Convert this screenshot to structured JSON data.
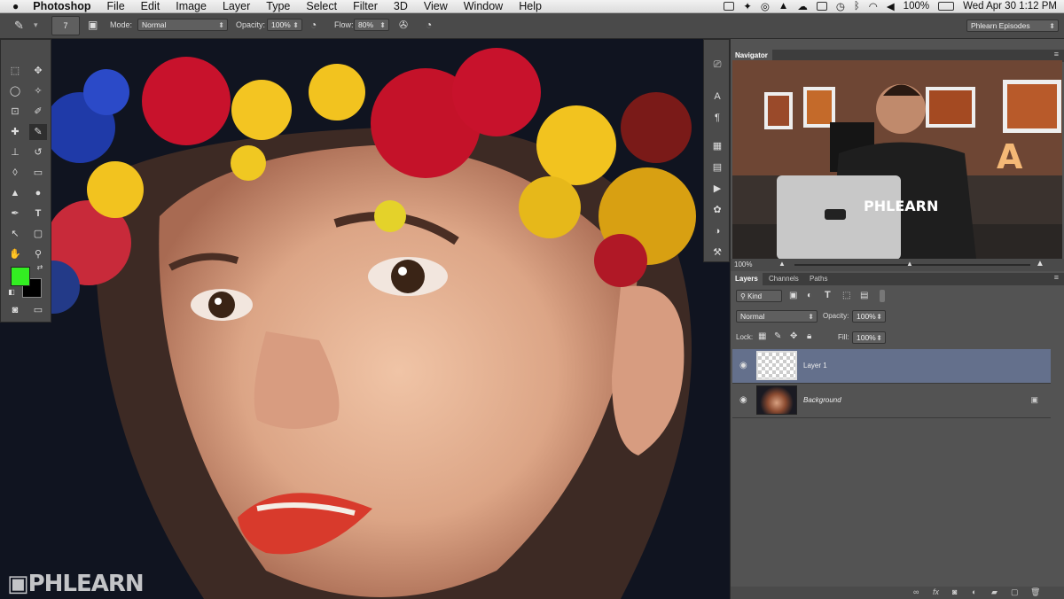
{
  "menubar": {
    "app_name": "Photoshop",
    "items": [
      "File",
      "Edit",
      "Image",
      "Layer",
      "Type",
      "Select",
      "Filter",
      "3D",
      "View",
      "Window",
      "Help"
    ],
    "battery": "100%",
    "datetime": "Wed Apr 30  1:12 PM"
  },
  "options": {
    "brush_size": "7",
    "mode_label": "Mode:",
    "mode_value": "Normal",
    "opacity_label": "Opacity:",
    "opacity_value": "100%",
    "flow_label": "Flow:",
    "flow_value": "80%",
    "workspace": "Phlearn Episodes"
  },
  "watermark": "PHLEARN",
  "navigator": {
    "tab": "Navigator",
    "zoom": "100%",
    "shirt_text": "PHLEARN",
    "sign_letter": "A"
  },
  "layers_panel": {
    "tabs": [
      "Layers",
      "Channels",
      "Paths"
    ],
    "kind": "Kind",
    "blend_mode": "Normal",
    "opacity_label": "Opacity:",
    "opacity_value": "100%",
    "lock_label": "Lock:",
    "fill_label": "Fill:",
    "fill_value": "100%",
    "layers": [
      {
        "name": "Layer 1",
        "selected": true
      },
      {
        "name": "Background",
        "selected": false,
        "locked": true
      }
    ]
  },
  "colors": {
    "foreground": "#33ee22",
    "background": "#000000",
    "selected_layer": "#64708c"
  }
}
